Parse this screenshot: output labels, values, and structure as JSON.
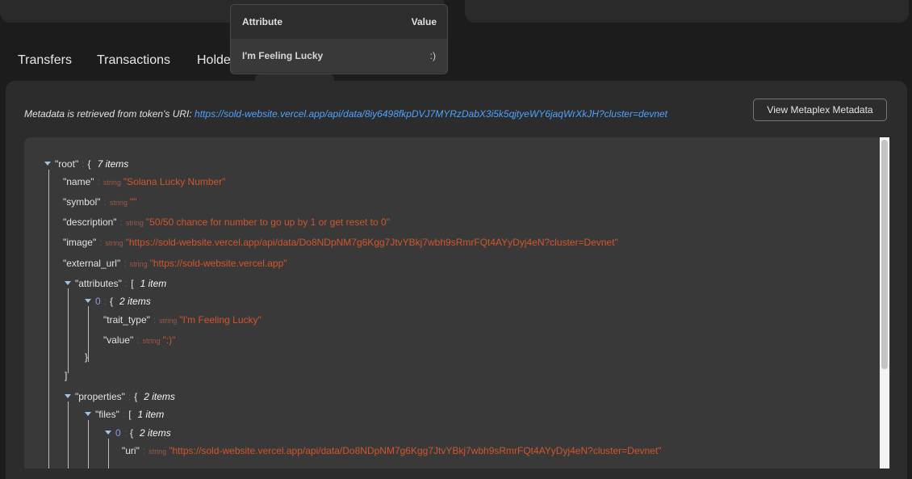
{
  "tabs": [
    "Transfers",
    "Transactions",
    "Holders"
  ],
  "attributes_popup": {
    "header_attribute": "Attribute",
    "header_value": "Value",
    "rows": [
      {
        "attribute": "I'm Feeling Lucky",
        "value": ":)"
      }
    ]
  },
  "metadata": {
    "intro": "Metadata is retrieved from token's URI:",
    "uri": "https://sold-website.vercel.app/api/data/8iy6498fkpDVJ7MYRzDabX3i5k5qjtyeWY6jaqWrXkJH?cluster=devnet",
    "button_label": "View Metaplex Metadata"
  },
  "json_view": {
    "type_label": "string",
    "root": {
      "key": "\"root\"",
      "brace": "{",
      "count": "7 items"
    },
    "name": {
      "key": "\"name\"",
      "value": "\"Solana Lucky Number\""
    },
    "symbol": {
      "key": "\"symbol\"",
      "value": "\"\""
    },
    "description": {
      "key": "\"description\"",
      "value": "\"50/50 chance for number to go up by 1 or get reset to 0\""
    },
    "image": {
      "key": "\"image\"",
      "value": "\"https://sold-website.vercel.app/api/data/Do8NDpNM7g6Kgg7JtvYBkj7wbh9sRmrFQt4AYyDyj4eN?cluster=Devnet\""
    },
    "external_url": {
      "key": "\"external_url\"",
      "value": "\"https://sold-website.vercel.app\""
    },
    "attributes": {
      "key": "\"attributes\"",
      "brace": "[",
      "count": "1 item",
      "close": "]"
    },
    "attr_0": {
      "key": "0",
      "brace": "{",
      "count": "2 items",
      "close": "}"
    },
    "trait_type": {
      "key": "\"trait_type\"",
      "value": "\"I'm Feeling Lucky\""
    },
    "trait_value": {
      "key": "\"value\"",
      "value": "\":)\""
    },
    "properties": {
      "key": "\"properties\"",
      "brace": "{",
      "count": "2 items"
    },
    "files": {
      "key": "\"files\"",
      "brace": "[",
      "count": "1 item"
    },
    "file_0": {
      "key": "0",
      "brace": "{",
      "count": "2 items"
    },
    "uri": {
      "key": "\"uri\"",
      "value": "\"https://sold-website.vercel.app/api/data/Do8NDpNM7g6Kgg7JtvYBkj7wbh9sRmrFQt4AYyDyj4eN?cluster=Devnet\""
    }
  }
}
